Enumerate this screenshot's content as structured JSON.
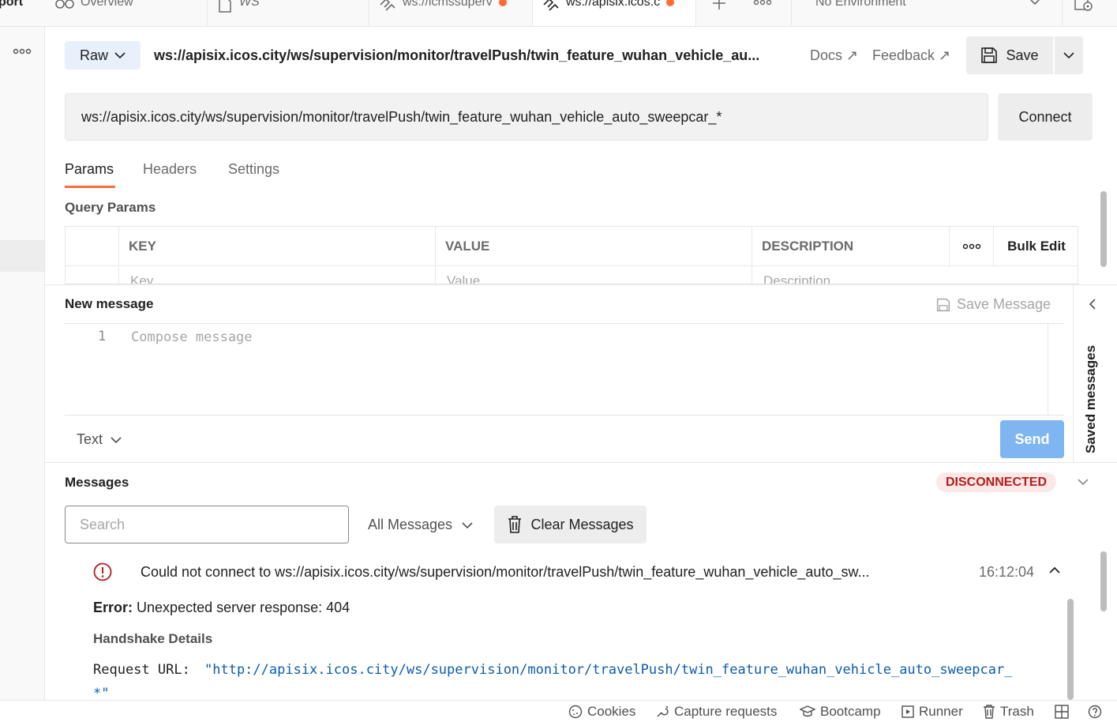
{
  "tabs": [
    {
      "label": "Overview",
      "icon": "overview-icon",
      "modified": false,
      "active": false
    },
    {
      "label": "WS",
      "icon": "document-icon",
      "modified": false,
      "active": false
    },
    {
      "label": "ws://icmssuperv",
      "icon": "websocket-icon",
      "modified": true,
      "active": false
    },
    {
      "label": "ws://apisix.icos.c",
      "icon": "websocket-icon",
      "modified": true,
      "active": true
    }
  ],
  "sidebar_partial_label": "port",
  "environment": "No Environment",
  "request": {
    "mode": "Raw",
    "title": "ws://apisix.icos.city/ws/supervision/monitor/travelPush/twin_feature_wuhan_vehicle_au...",
    "docs_label": "Docs ↗",
    "feedback_label": "Feedback ↗",
    "save_label": "Save",
    "url": "ws://apisix.icos.city/ws/supervision/monitor/travelPush/twin_feature_wuhan_vehicle_auto_sweepcar_*",
    "connect_label": "Connect"
  },
  "param_tabs": [
    "Params",
    "Headers",
    "Settings"
  ],
  "query_params": {
    "title": "Query Params",
    "columns": [
      "KEY",
      "VALUE",
      "DESCRIPTION"
    ],
    "more_label": "ooo",
    "bulk_edit_label": "Bulk Edit",
    "placeholders": [
      "Key",
      "Value",
      "Description"
    ]
  },
  "new_message": {
    "title": "New message",
    "save_message_label": "Save Message",
    "line_number": "1",
    "placeholder": "Compose message",
    "format": "Text",
    "send_label": "Send",
    "saved_messages_label": "Saved messages"
  },
  "messages": {
    "title": "Messages",
    "status": "DISCONNECTED",
    "search_placeholder": "Search",
    "filter": "All Messages",
    "clear_label": "Clear Messages",
    "entry": {
      "text": "Could not connect to ws://apisix.icos.city/ws/supervision/monitor/travelPush/twin_feature_wuhan_vehicle_auto_sw...",
      "time": "16:12:04",
      "error_label": "Error:",
      "error_text": "Unexpected server response: 404",
      "handshake_title": "Handshake Details",
      "request_url_label": "Request URL:",
      "request_url_line1": "\"http://apisix.icos.city/ws/supervision/monitor/travelPush/twin_feature_wuhan_vehicle_auto_sweepcar_",
      "request_url_line2": "*\""
    }
  },
  "statusbar": [
    "Cookies",
    "Capture requests",
    "Bootcamp",
    "Runner",
    "Trash"
  ],
  "colors": {
    "accent": "#ff6c37",
    "send": "#7fb5f0",
    "error": "#b71c1c",
    "link": "#0b5cad"
  }
}
